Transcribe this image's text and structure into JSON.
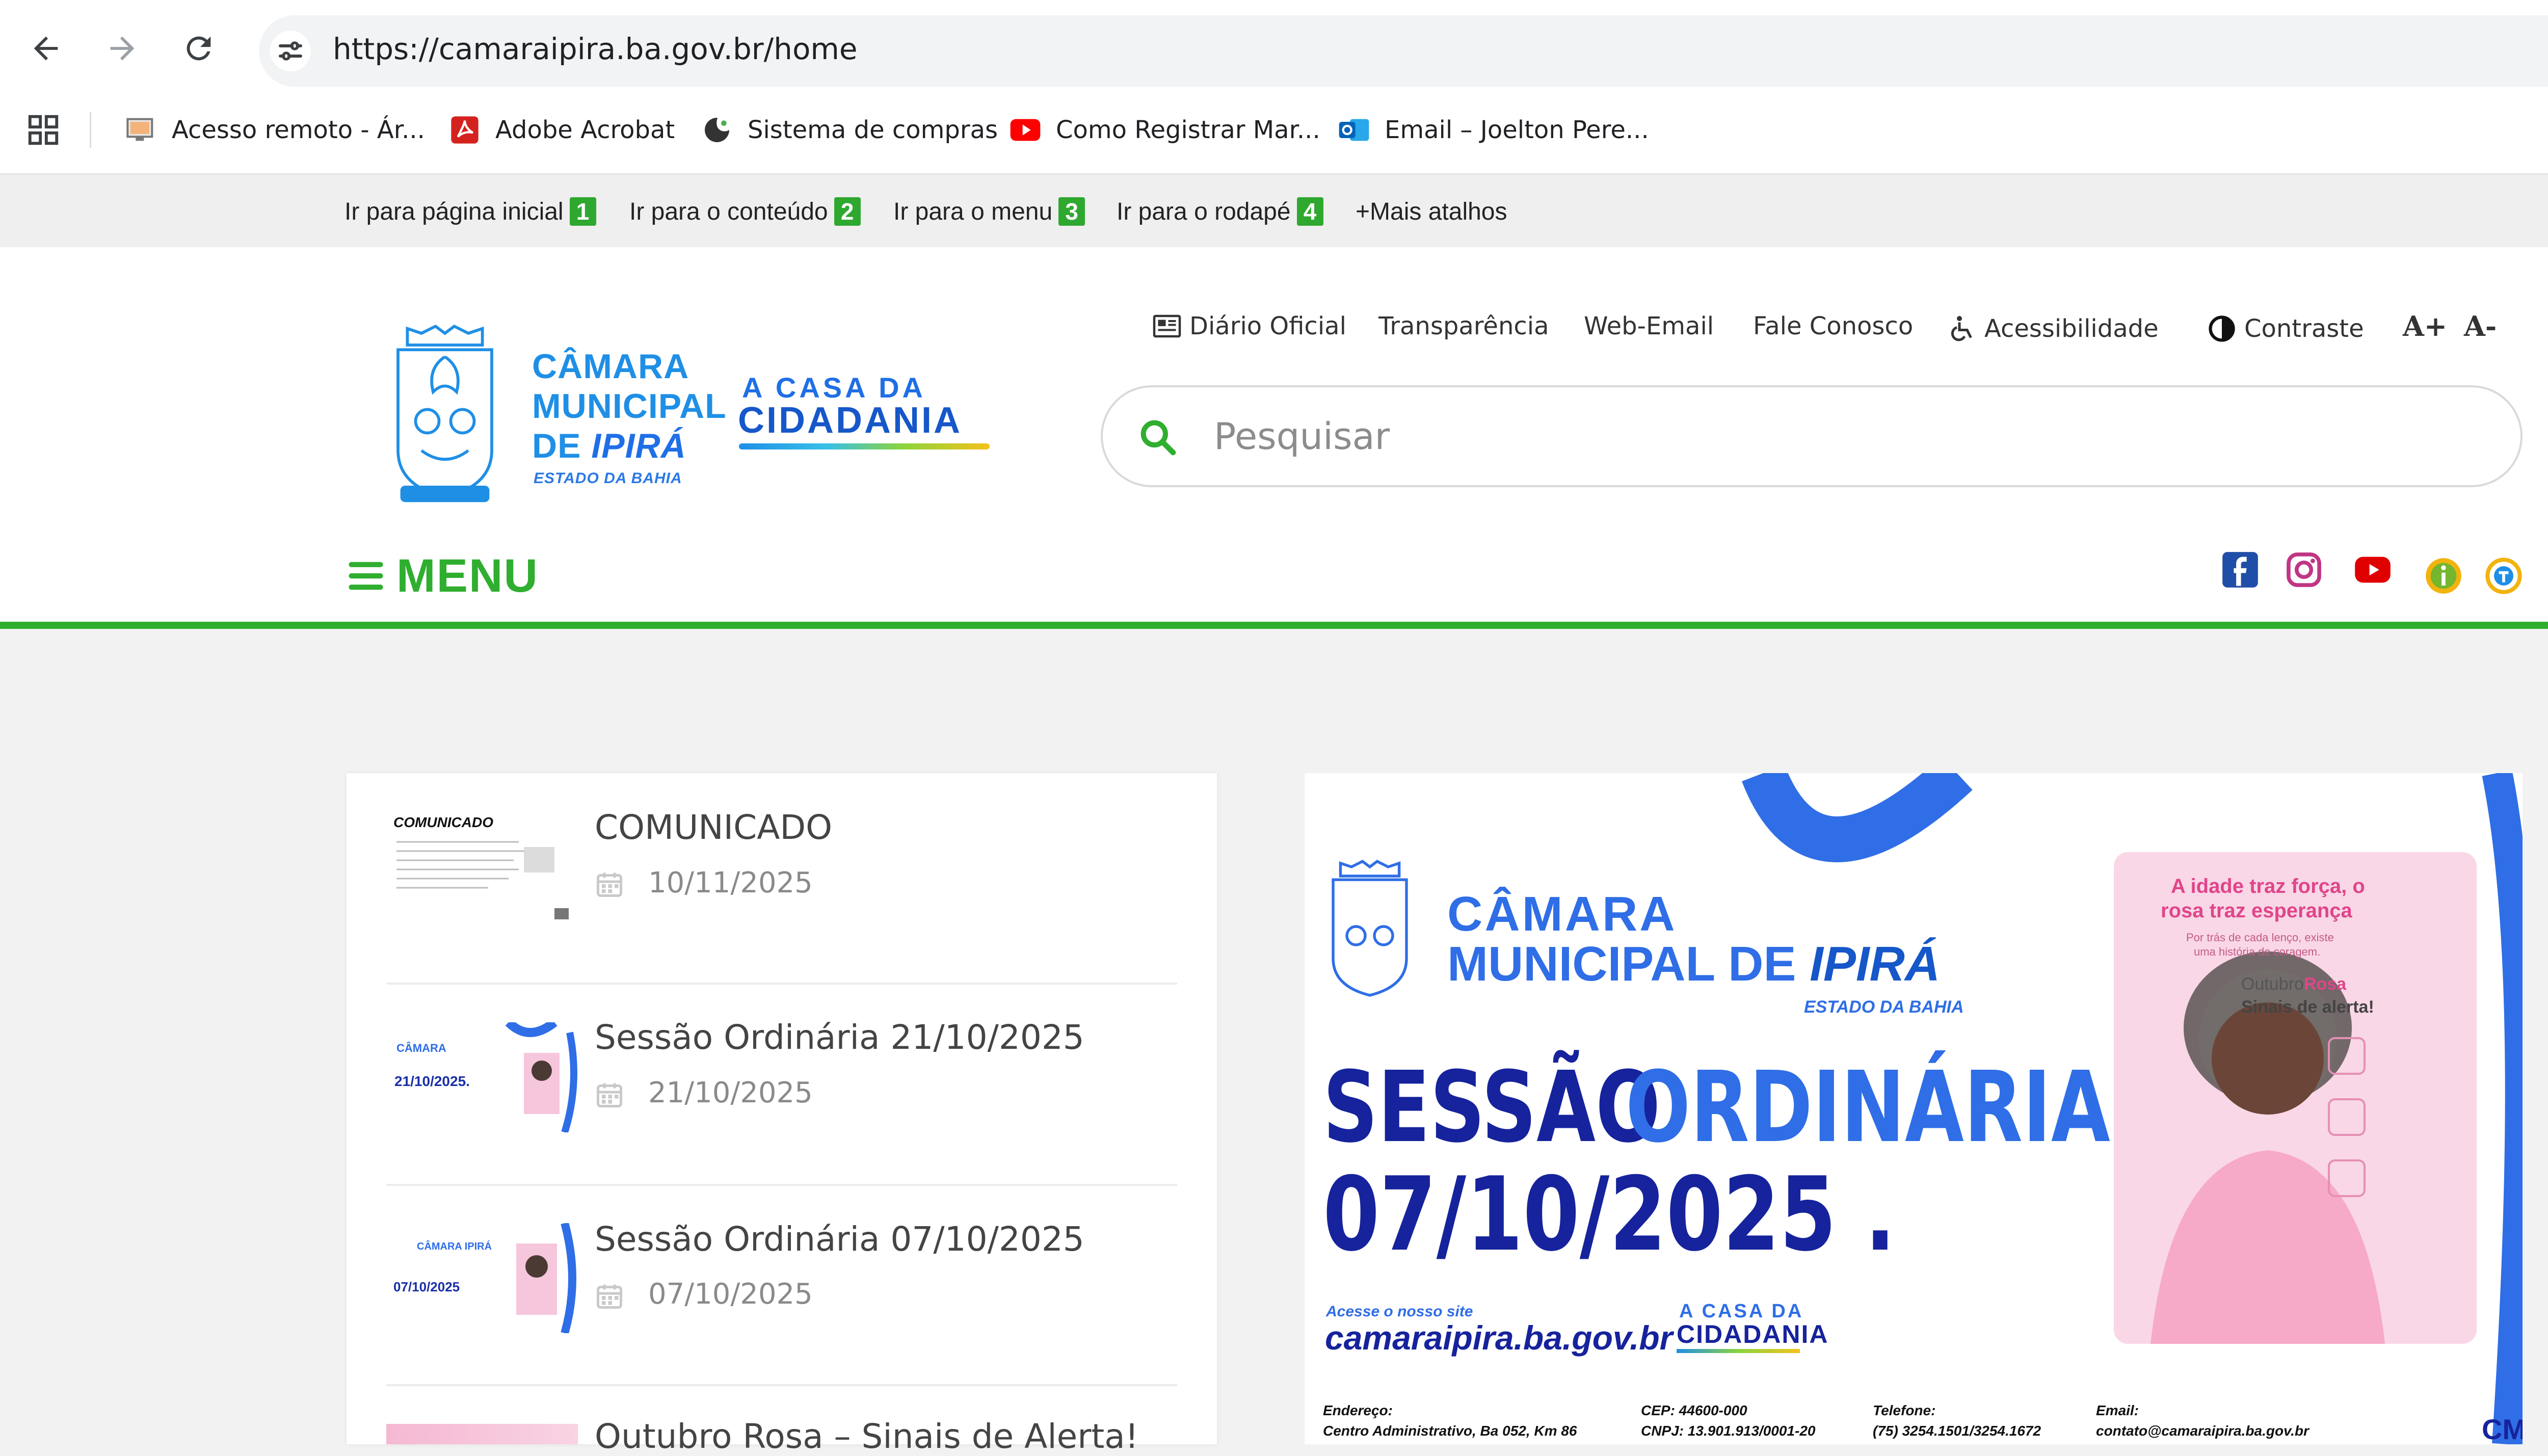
{
  "browser": {
    "url": "https://camaraipira.ba.gov.br/home",
    "bookmarks": [
      {
        "label": "Acesso remoto - Ár...",
        "icon": "remote-desktop-icon"
      },
      {
        "label": "Adobe Acrobat",
        "icon": "adobe-acrobat-icon"
      },
      {
        "label": "Sistema de compras",
        "icon": "shopping-system-icon"
      },
      {
        "label": "Como Registrar Mar...",
        "icon": "youtube-icon"
      },
      {
        "label": "Email – Joelton Pere...",
        "icon": "outlook-icon"
      }
    ]
  },
  "shortcuts": [
    {
      "label": "Ir para página inicial",
      "key": "1"
    },
    {
      "label": "Ir para o conteúdo",
      "key": "2"
    },
    {
      "label": "Ir para o menu",
      "key": "3"
    },
    {
      "label": "Ir para o rodapé",
      "key": "4"
    },
    {
      "label": "+Mais atalhos"
    }
  ],
  "logo": {
    "line1": "CÂMARA",
    "line2": "MUNICIPAL",
    "line3_prefix": "DE ",
    "line3_emph": "IPIRÁ",
    "line4": "ESTADO DA BAHIA",
    "tagline1": "A CASA DA",
    "tagline2": "CIDADANIA"
  },
  "top_links": {
    "diario": "Diário Oficial",
    "transparencia": "Transparência",
    "webmail": "Web-Email",
    "contato": "Fale Conosco",
    "acessibilidade": "Acessibilidade",
    "contraste": "Contraste",
    "font_up": "A+",
    "font_down": "A-"
  },
  "search": {
    "placeholder": "Pesquisar"
  },
  "menu": {
    "label": "MENU"
  },
  "social": [
    "facebook-icon",
    "instagram-icon",
    "youtube-icon",
    "info-icon",
    "transparency-portal-icon"
  ],
  "news": [
    {
      "title": "COMUNICADO",
      "date": "10/11/2025",
      "thumb_text": "COMUNICADO"
    },
    {
      "title": "Sessão Ordinária 21/10/2025",
      "date": "21/10/2025",
      "thumb_text": "21/10/2025."
    },
    {
      "title": "Sessão Ordinária 07/10/2025",
      "date": "07/10/2025",
      "thumb_text": "07/10/2025"
    },
    {
      "title": "Outubro Rosa – Sinais de Alerta!",
      "date": ""
    }
  ],
  "banner": {
    "org_line1": "CÂMARA",
    "org_line2_prefix": "MUNICIPAL DE ",
    "org_line2_emph": "IPIRÁ",
    "org_state": "ESTADO DA BAHIA",
    "headline1": "SESSÃO",
    "headline2": "ORDINÁRIA",
    "headline_date": "07/10/2025 .",
    "site_intro": "Acesse o nosso site",
    "site_url": "camaraipira.ba.gov.br",
    "tag1": "A CASA DA",
    "tag2": "CIDADANIA",
    "footer": {
      "endereco_label": "Endereço:",
      "endereco": "Centro Administrativo, Ba 052, Km 86",
      "cep": "CEP: 44600-000",
      "cnpj": "CNPJ: 13.901.913/0001-20",
      "telefone_label": "Telefone:",
      "telefone": "(75) 3254.1501/3254.1672",
      "email_label": "Email:",
      "email": "contato@camaraipira.ba.gov.br",
      "corner": "CM"
    },
    "poster": {
      "title1": "A idade traz força, o",
      "title2": "rosa traz esperança",
      "sub1": "Por trás de cada lenço, existe",
      "sub2": "uma história de coragem.",
      "campaign_prefix": "Outubro",
      "campaign_emph": "Rosa",
      "alert": "Sinais de alerta!"
    }
  }
}
